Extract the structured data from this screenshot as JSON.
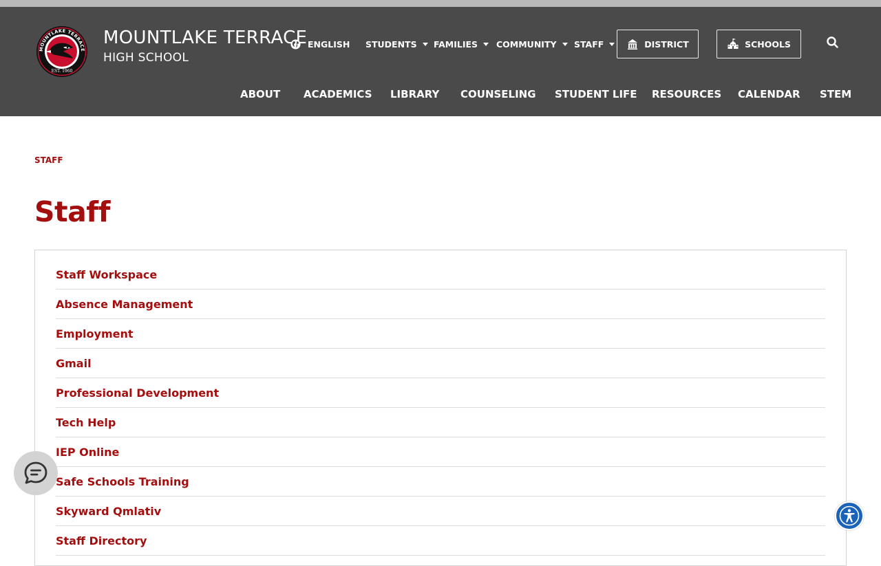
{
  "site": {
    "name_line1": "MOUNTLAKE TERRACE",
    "name_line2": "HIGH SCHOOL",
    "logo_text_top": "MOUNTLAKE TERRACE",
    "logo_text_bottom": "EST. 1960"
  },
  "utility_nav": {
    "language": "ENGLISH",
    "items": [
      "STUDENTS",
      "FAMILIES",
      "COMMUNITY",
      "STAFF"
    ],
    "district_label": "DISTRICT",
    "schools_label": "SCHOOLS"
  },
  "main_nav": [
    "ABOUT",
    "ACADEMICS",
    "LIBRARY",
    "COUNSELING",
    "STUDENT LIFE",
    "RESOURCES",
    "CALENDAR",
    "STEM"
  ],
  "breadcrumb": "STAFF",
  "page_title": "Staff",
  "links": [
    "Staff Workspace",
    "Absence Management",
    "Employment",
    "Gmail",
    "Professional Development",
    "Tech Help",
    "IEP Online",
    "Safe Schools Training",
    "Skyward Qmlativ",
    "Staff Directory"
  ],
  "colors": {
    "header_bg": "#4a4a4a",
    "accent": "#a50e0e",
    "accessibility_blue": "#1a63b8"
  }
}
